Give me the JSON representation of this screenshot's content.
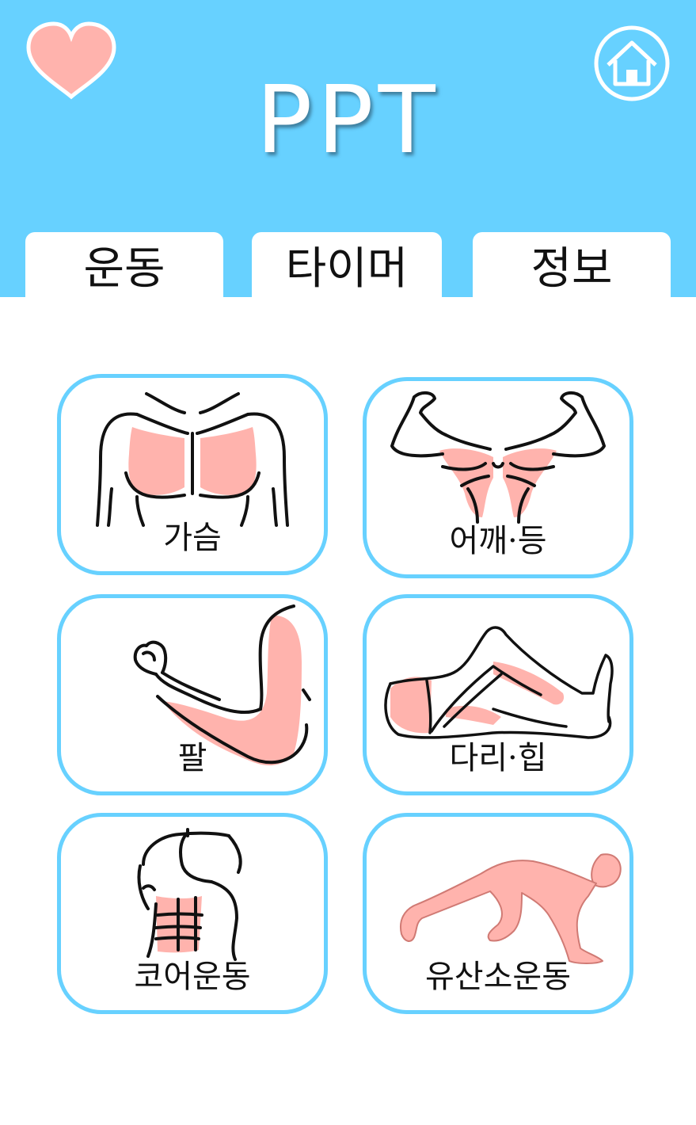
{
  "app": {
    "title": "PPT"
  },
  "colors": {
    "accent": "#67d1ff",
    "heart": "#ffb3ad",
    "muscle_highlight": "#ffb3ad",
    "tab_background": "#ffffff",
    "text": "#111111"
  },
  "header": {
    "left_icon": "heart-icon",
    "right_icon": "home-icon"
  },
  "tabs": [
    {
      "label": "운동"
    },
    {
      "label": "타이머"
    },
    {
      "label": "정보"
    }
  ],
  "categories": [
    {
      "label": "가슴",
      "icon": "chest-muscle-icon"
    },
    {
      "label": "어깨·등",
      "icon": "shoulder-back-muscle-icon"
    },
    {
      "label": "팔",
      "icon": "arm-muscle-icon"
    },
    {
      "label": "다리·힙",
      "icon": "leg-hip-muscle-icon"
    },
    {
      "label": "코어운동",
      "icon": "core-muscle-icon"
    },
    {
      "label": "유산소운동",
      "icon": "cardio-figure-icon"
    }
  ]
}
